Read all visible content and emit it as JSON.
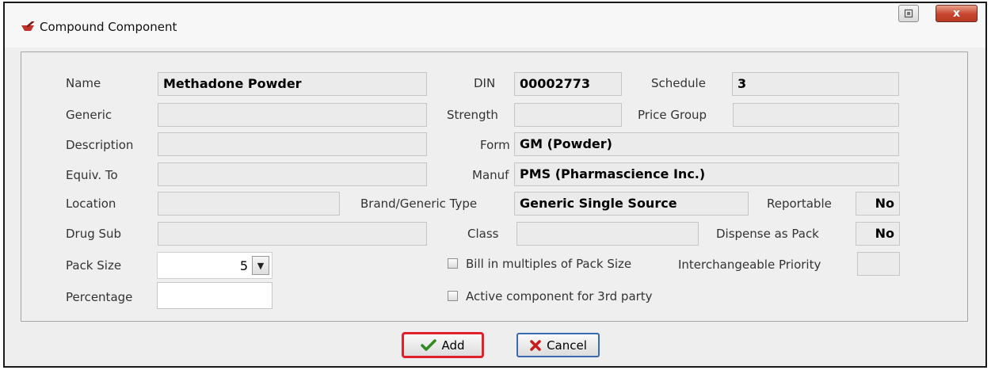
{
  "window": {
    "title": "Compound Component",
    "close_glyph": "x"
  },
  "colors": {
    "highlight": "#e0202a",
    "checkmark": "#2f8a1f",
    "cancel_x": "#c81e1e"
  },
  "icons": {
    "app": "mortar-pestle-icon",
    "restore": "restore-icon",
    "close": "close-icon",
    "add": "checkmark-icon",
    "cancel": "red-x-icon"
  },
  "labels": {
    "name": "Name",
    "generic": "Generic",
    "description": "Description",
    "equiv_to": "Equiv. To",
    "location": "Location",
    "drug_sub": "Drug Sub",
    "pack_size": "Pack Size",
    "percentage": "Percentage",
    "din": "DIN",
    "strength": "Strength",
    "form": "Form",
    "manuf": "Manuf",
    "brand_generic_type": "Brand/Generic Type",
    "class": "Class",
    "schedule": "Schedule",
    "price_group": "Price Group",
    "reportable": "Reportable",
    "dispense_as_pack": "Dispense as Pack",
    "interchangeable_priority": "Interchangeable Priority"
  },
  "fields": {
    "name": "Methadone Powder",
    "generic": "",
    "description": "",
    "equiv_to": "",
    "location": "",
    "drug_sub": "",
    "pack_size": "5",
    "percentage": "",
    "din": "00002773",
    "strength": "",
    "form": "GM (Powder)",
    "manuf": "PMS (Pharmascience Inc.)",
    "brand_generic_type": "Generic Single Source",
    "class": "",
    "schedule": "3",
    "price_group": "",
    "reportable": "No",
    "dispense_as_pack": "No",
    "interchangeable_priority": ""
  },
  "checkboxes": {
    "bill_multiples": {
      "label": "Bill in multiples of Pack Size",
      "checked": false
    },
    "active_component": {
      "label": "Active component for 3rd party",
      "checked": false
    }
  },
  "buttons": {
    "add": "Add",
    "cancel": "Cancel"
  }
}
